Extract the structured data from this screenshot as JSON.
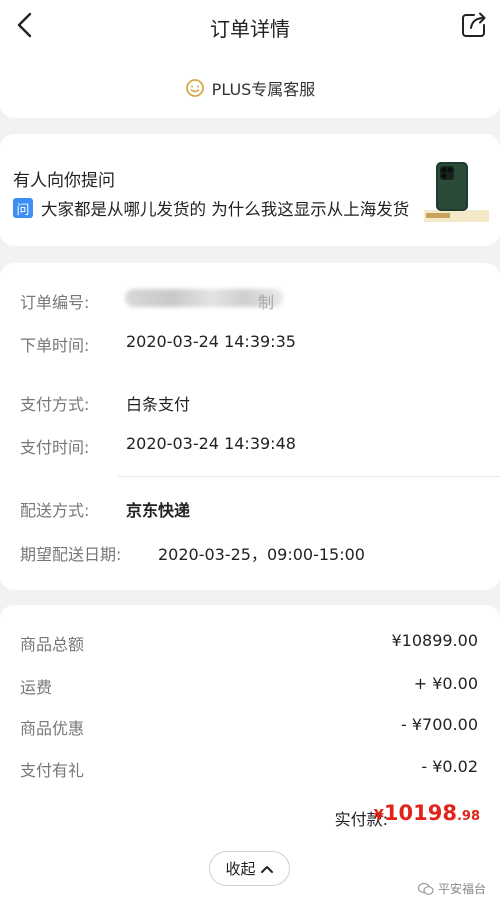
{
  "navbar": {
    "title": "订单详情"
  },
  "service": {
    "label": "PLUS专属客服"
  },
  "question": {
    "title": "有人向你提问",
    "badge": "问",
    "text": "大家都是从哪儿发货的 为什么我这显示从上海发货"
  },
  "order": {
    "number_label": "订单编号:",
    "number_suffix": "制",
    "order_time_label": "下单时间:",
    "order_time": "2020-03-24 14:39:35",
    "pay_method_label": "支付方式:",
    "pay_method": "白条支付",
    "pay_time_label": "支付时间:",
    "pay_time": "2020-03-24 14:39:48",
    "delivery_label": "配送方式:",
    "delivery": "京东快递",
    "expected_label": "期望配送日期:",
    "expected": "2020-03-25，09:00-15:00"
  },
  "amounts": {
    "total_label": "商品总额",
    "total": "¥10899.00",
    "shipping_label": "运费",
    "shipping": "+ ¥0.00",
    "discount_label": "商品优惠",
    "discount": "- ¥700.00",
    "gift_label": "支付有礼",
    "gift": "- ¥0.02",
    "paid_label": "实付款:",
    "paid_currency": "¥",
    "paid_integer": "10198",
    "paid_decimal": ".98"
  },
  "collapse_label": "收起",
  "watermark": "平安福台",
  "colors": {
    "accent_red": "#e1251b",
    "badge_blue": "#3e8ef7",
    "plus_gold": "#d4a94a"
  }
}
